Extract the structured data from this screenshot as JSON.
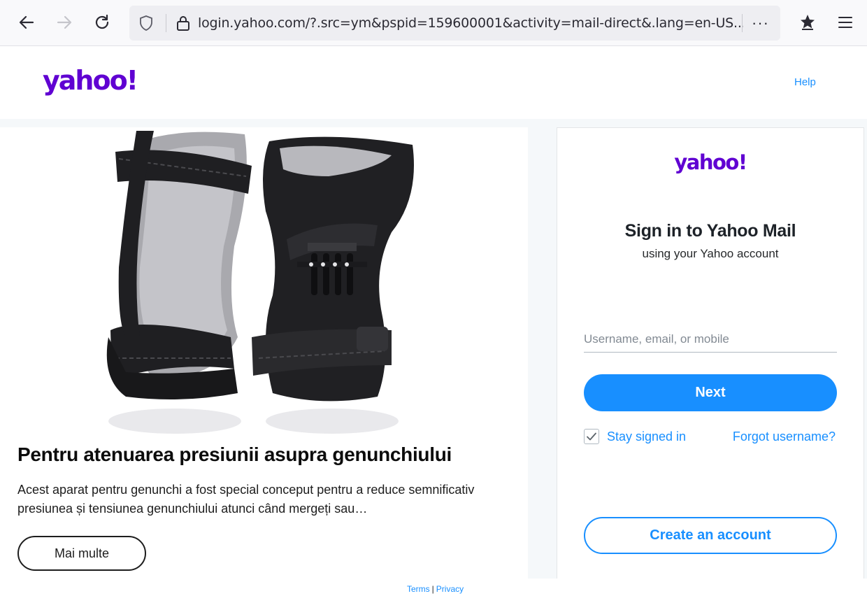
{
  "browser": {
    "url": "login.yahoo.com/?.src=ym&pspid=159600001&activity=mail-direct&.lang=en-US...",
    "more_label": "···"
  },
  "header": {
    "logo_text": "yahoo!",
    "help_label": "Help"
  },
  "ad": {
    "title": "Pentru atenuarea presiunii asupra genunchiului",
    "description": "Acest aparat pentru genunchi a fost special conceput pentru a reduce semnificativ presiunea și tensiunea genunchiului atunci când mergeți sau…",
    "button_label": "Mai multe"
  },
  "login": {
    "logo_text": "yahoo!",
    "title": "Sign in to Yahoo Mail",
    "subtitle": "using your Yahoo account",
    "username_placeholder": "Username, email, or mobile",
    "next_label": "Next",
    "stay_signed_in_label": "Stay signed in",
    "stay_signed_in_checked": true,
    "forgot_label": "Forgot username?",
    "create_label": "Create an account"
  },
  "footer": {
    "terms_label": "Terms",
    "separator": "|",
    "privacy_label": "Privacy"
  },
  "colors": {
    "brand_purple": "#6001d2",
    "link_blue": "#188fff"
  }
}
